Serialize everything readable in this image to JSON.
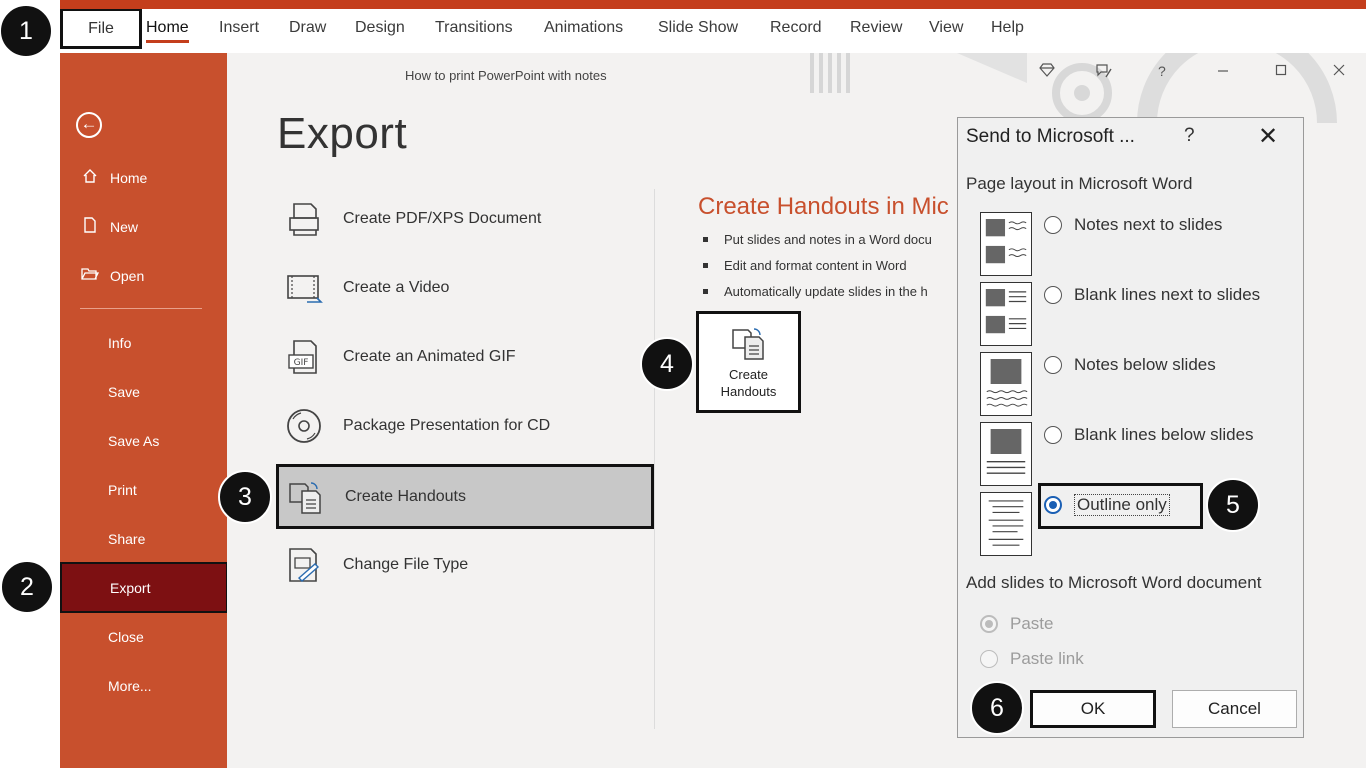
{
  "ribbon": {
    "tabs": [
      "File",
      "Home",
      "Insert",
      "Draw",
      "Design",
      "Transitions",
      "Animations",
      "Slide Show",
      "Record",
      "Review",
      "View",
      "Help"
    ],
    "active_tab": "Home"
  },
  "window": {
    "document_title": "How to print PowerPoint with notes",
    "help_glyph": "?"
  },
  "backstage_nav": {
    "items": [
      {
        "label": "Home",
        "icon": "home-icon"
      },
      {
        "label": "New",
        "icon": "new-document-icon"
      },
      {
        "label": "Open",
        "icon": "folder-open-icon"
      },
      {
        "label": "Info"
      },
      {
        "label": "Save"
      },
      {
        "label": "Save As"
      },
      {
        "label": "Print"
      },
      {
        "label": "Share"
      },
      {
        "label": "Export"
      },
      {
        "label": "Close"
      },
      {
        "label": "More..."
      }
    ],
    "selected": "Export"
  },
  "export": {
    "title": "Export",
    "options": [
      {
        "label": "Create PDF/XPS Document",
        "icon": "pdf-document-icon"
      },
      {
        "label": "Create a Video",
        "icon": "video-icon"
      },
      {
        "label": "Create an Animated GIF",
        "icon": "gif-icon"
      },
      {
        "label": "Package Presentation for CD",
        "icon": "cd-icon"
      },
      {
        "label": "Create Handouts",
        "icon": "handouts-icon"
      },
      {
        "label": "Change File Type",
        "icon": "change-file-type-icon"
      }
    ],
    "selected": "Create Handouts"
  },
  "detail": {
    "title": "Create Handouts in Mic",
    "bullets": [
      "Put slides and notes in a Word docu",
      "Edit and format content in Word",
      "Automatically update slides in the h"
    ],
    "button_line1": "Create",
    "button_line2": "Handouts"
  },
  "dialog": {
    "title": "Send to Microsoft ...",
    "help": "?",
    "close": "✕",
    "layout_heading": "Page layout in Microsoft Word",
    "layouts": [
      {
        "label": "Notes next to slides",
        "checked": false
      },
      {
        "label": "Blank lines next to slides",
        "checked": false
      },
      {
        "label": "Notes below slides",
        "checked": false
      },
      {
        "label": "Blank lines below slides",
        "checked": false
      },
      {
        "label": "Outline only",
        "checked": true
      }
    ],
    "add_heading": "Add slides to Microsoft Word document",
    "add_options": [
      {
        "label": "Paste",
        "checked": true,
        "enabled": false
      },
      {
        "label": "Paste link",
        "checked": false,
        "enabled": false
      }
    ],
    "ok_label": "OK",
    "cancel_label": "Cancel"
  },
  "steps": [
    "1",
    "2",
    "3",
    "4",
    "5",
    "6"
  ],
  "colors": {
    "accent": "#c8502d",
    "export_selected": "#7d1012",
    "radio_selected": "#1a5fb4"
  }
}
